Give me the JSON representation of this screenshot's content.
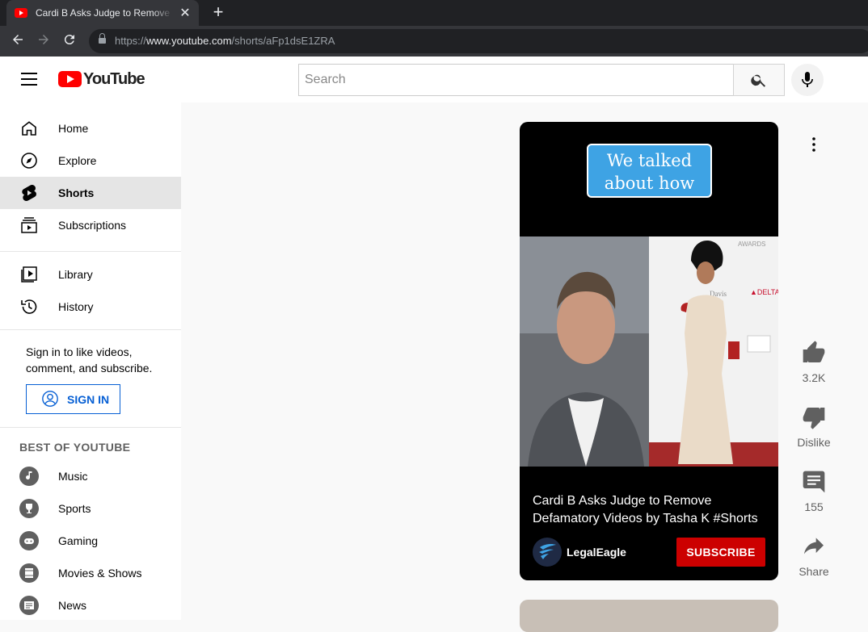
{
  "browser": {
    "tab_title": "Cardi B Asks Judge to Remove Defamatory Videos by Tasha K #Shorts - YouTube",
    "new_tab": "+",
    "close": "✕",
    "url_scheme": "https://",
    "url_host": "www.youtube.com",
    "url_path": "/shorts/aFp1dsE1ZRA"
  },
  "masthead": {
    "logo_text": "YouTube",
    "search_placeholder": "Search"
  },
  "sidebar": {
    "main_items": [
      {
        "label": "Home",
        "icon": "home-icon"
      },
      {
        "label": "Explore",
        "icon": "compass-icon"
      },
      {
        "label": "Shorts",
        "icon": "shorts-icon",
        "active": true
      },
      {
        "label": "Subscriptions",
        "icon": "subscriptions-icon"
      }
    ],
    "library_items": [
      {
        "label": "Library",
        "icon": "library-icon"
      },
      {
        "label": "History",
        "icon": "history-icon"
      }
    ],
    "signin_text": "Sign in to like videos, comment, and subscribe.",
    "signin_button": "SIGN IN",
    "section_title": "BEST OF YOUTUBE",
    "best_items": [
      {
        "label": "Music",
        "icon": "music-icon"
      },
      {
        "label": "Sports",
        "icon": "trophy-icon"
      },
      {
        "label": "Gaming",
        "icon": "gaming-icon"
      },
      {
        "label": "Movies & Shows",
        "icon": "film-icon"
      },
      {
        "label": "News",
        "icon": "news-icon"
      }
    ]
  },
  "short": {
    "overlay_caption_line1": "We talked",
    "overlay_caption_line2": "about how",
    "title": "Cardi B Asks Judge to Remove Defamatory Videos by Tasha K #Shorts",
    "channel": "LegalEagle",
    "subscribe_label": "SUBSCRIBE"
  },
  "actions": {
    "like_count": "3.2K",
    "dislike_label": "Dislike",
    "comment_count": "155",
    "share_label": "Share"
  },
  "colors": {
    "brand_red": "#ff0000",
    "subscribe_red": "#cc0000",
    "link_blue": "#065fd4",
    "caption_blue": "#3ea3e4"
  }
}
